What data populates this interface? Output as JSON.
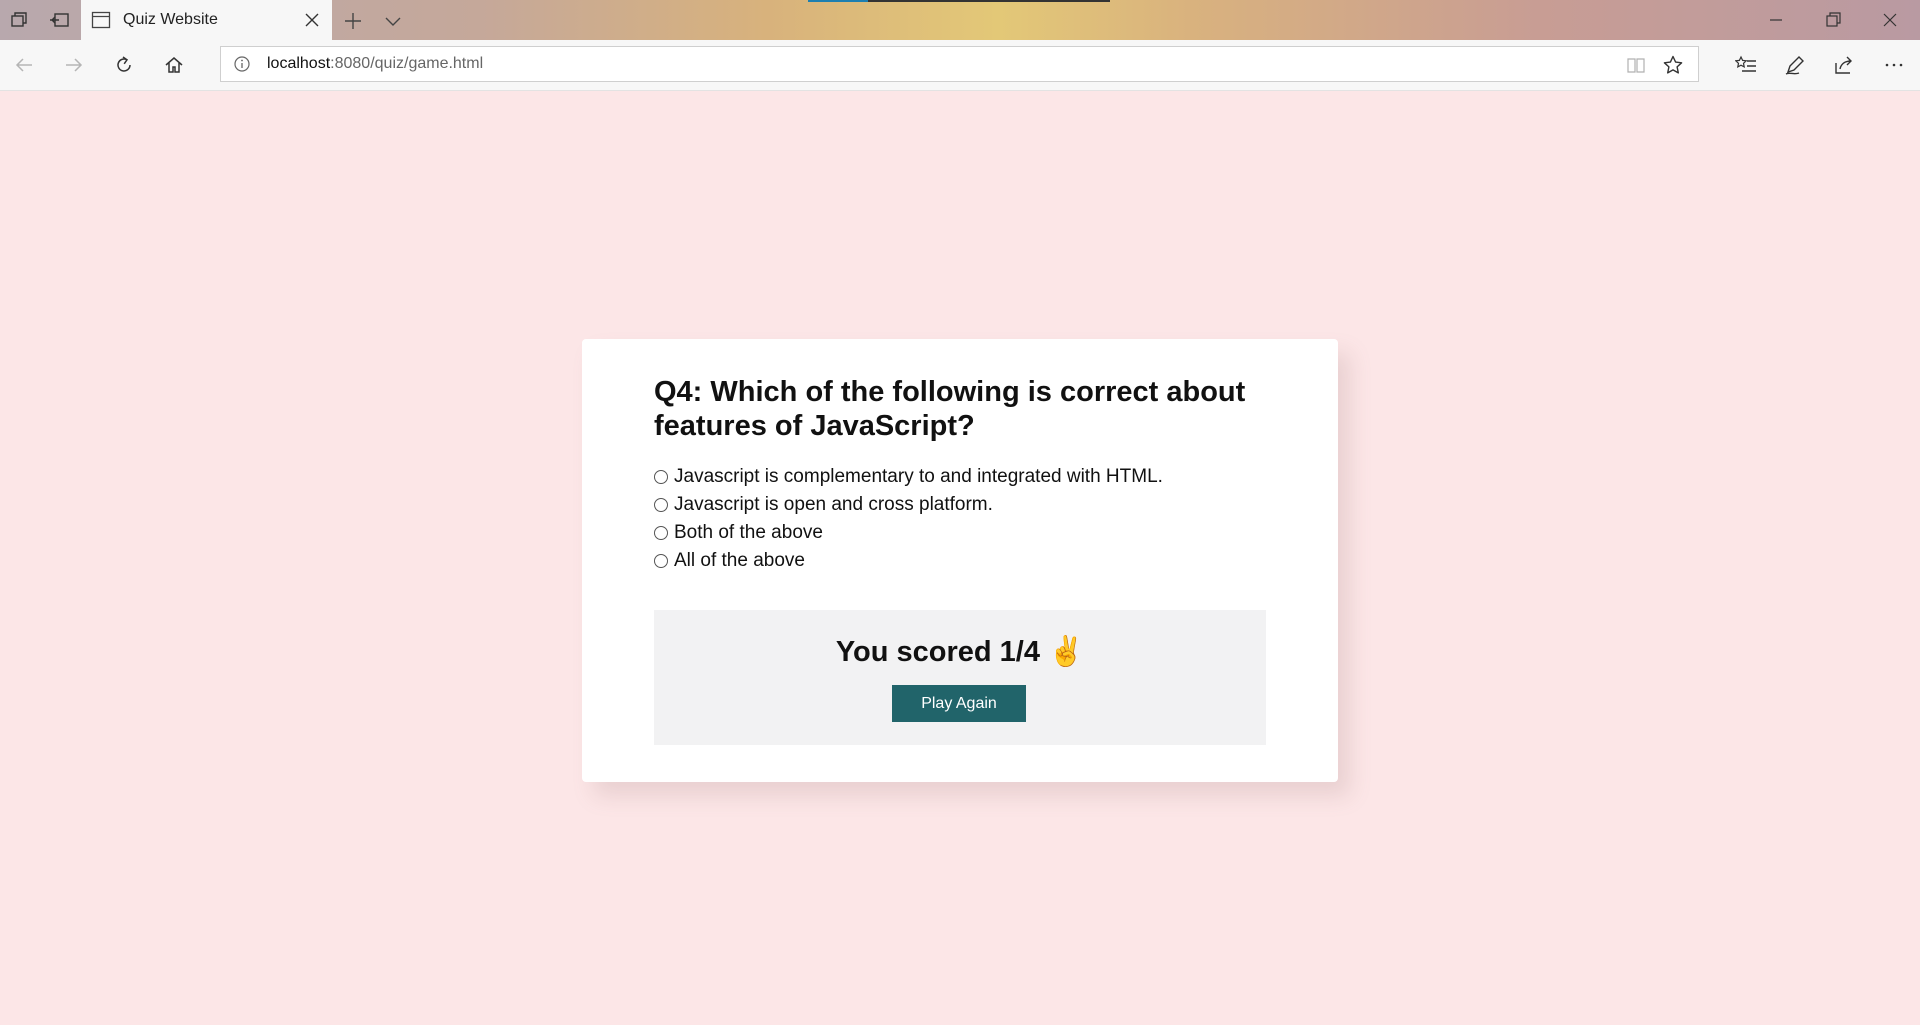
{
  "browser": {
    "tab_title": "Quiz Website",
    "url_host": "localhost",
    "url_path": ":8080/quiz/game.html",
    "icons": {
      "tab_actions": "tab-actions-icon",
      "set_aside": "set-aside-tabs-icon",
      "page": "page-icon",
      "close_tab": "close-icon",
      "new_tab": "plus-icon",
      "tab_menu": "chevron-down-icon",
      "minimize": "minimize-icon",
      "restore": "restore-icon",
      "close_window": "close-icon",
      "back": "back-arrow-icon",
      "forward": "forward-arrow-icon",
      "refresh": "refresh-icon",
      "home": "home-icon",
      "info": "info-icon",
      "reading_view": "reading-view-icon",
      "favorite": "star-icon",
      "favorites_hub": "favorites-list-icon",
      "notes": "pen-icon",
      "share": "share-icon",
      "more": "more-icon"
    }
  },
  "quiz": {
    "question": "Q4: Which of the following is correct about features of JavaScript?",
    "options": [
      "Javascript is complementary to and integrated with HTML.",
      "Javascript is open and cross platform.",
      "Both of the above",
      "All of the above"
    ],
    "score_text": "You scored 1/4",
    "score_emoji": "✌️",
    "play_again_label": "Play Again"
  },
  "colors": {
    "page_background": "#fce6e7",
    "button": "#21646a",
    "result_panel": "#f2f2f3"
  }
}
